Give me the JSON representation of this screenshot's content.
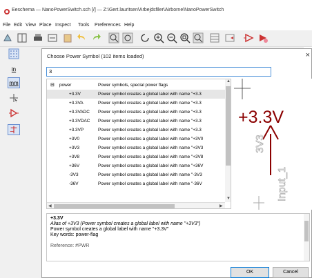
{
  "window": {
    "title": "Eeschema — NanoPowerSwitch.sch [/] — Z:\\Gert.lauritsen\\Arbejdsfiler\\Airborne\\NanoPowerSwitch"
  },
  "menu": [
    "File",
    "Edit",
    "View",
    "Place",
    "Inspect",
    "Tools",
    "Preferences",
    "Help"
  ],
  "left_toolbar": {
    "unit_in": "in",
    "unit_mm": "mm"
  },
  "dialog": {
    "title": "Choose Power Symbol (102 items loaded)",
    "close": "×",
    "filter_value": "3",
    "tree": [
      {
        "name": "power",
        "desc": "Power symbols, special power flags",
        "group": true,
        "expander": "⊟"
      },
      {
        "name": "+3.3V",
        "desc": "Power symbol creates a global label with name \"+3.3",
        "selected": true
      },
      {
        "name": "+3.3VA",
        "desc": "Power symbol creates a global label with name \"+3.3"
      },
      {
        "name": "+3.3VADC",
        "desc": "Power symbol creates a global label with name \"+3.3"
      },
      {
        "name": "+3.3VDAC",
        "desc": "Power symbol creates a global label with name \"+3.3"
      },
      {
        "name": "+3.3VP",
        "desc": "Power symbol creates a global label with name \"+3.3"
      },
      {
        "name": "+3V0",
        "desc": "Power symbol creates a global label with name \"+3V0"
      },
      {
        "name": "+3V3",
        "desc": "Power symbol creates a global label with name \"+3V3"
      },
      {
        "name": "+3V8",
        "desc": "Power symbol creates a global label with name \"+3V8"
      },
      {
        "name": "+36V",
        "desc": "Power symbol creates a global label with name \"+36V"
      },
      {
        "name": "-3V3",
        "desc": "Power symbol creates a global label with name \"-3V3"
      },
      {
        "name": "-36V",
        "desc": "Power symbol creates a global label with name \"-36V"
      }
    ],
    "preview": {
      "label": "+3.3V",
      "rot_name": "3V3",
      "rot_input": "Input_1"
    },
    "details": {
      "name": "+3.3V",
      "alias_line": "Alias of +3V3 (Power symbol creates a global label with name \"+3V3\")",
      "desc_line": "Power symbol creates a global label with name \"+3.3V\"",
      "keywords": "Key words: power-flag",
      "reference": "Reference: #PWR"
    },
    "ok_label": "OK",
    "cancel_label": "Cancel"
  },
  "colors": {
    "accent": "#0078d7",
    "symbol": "#8b0000",
    "pin": "#a04040"
  }
}
